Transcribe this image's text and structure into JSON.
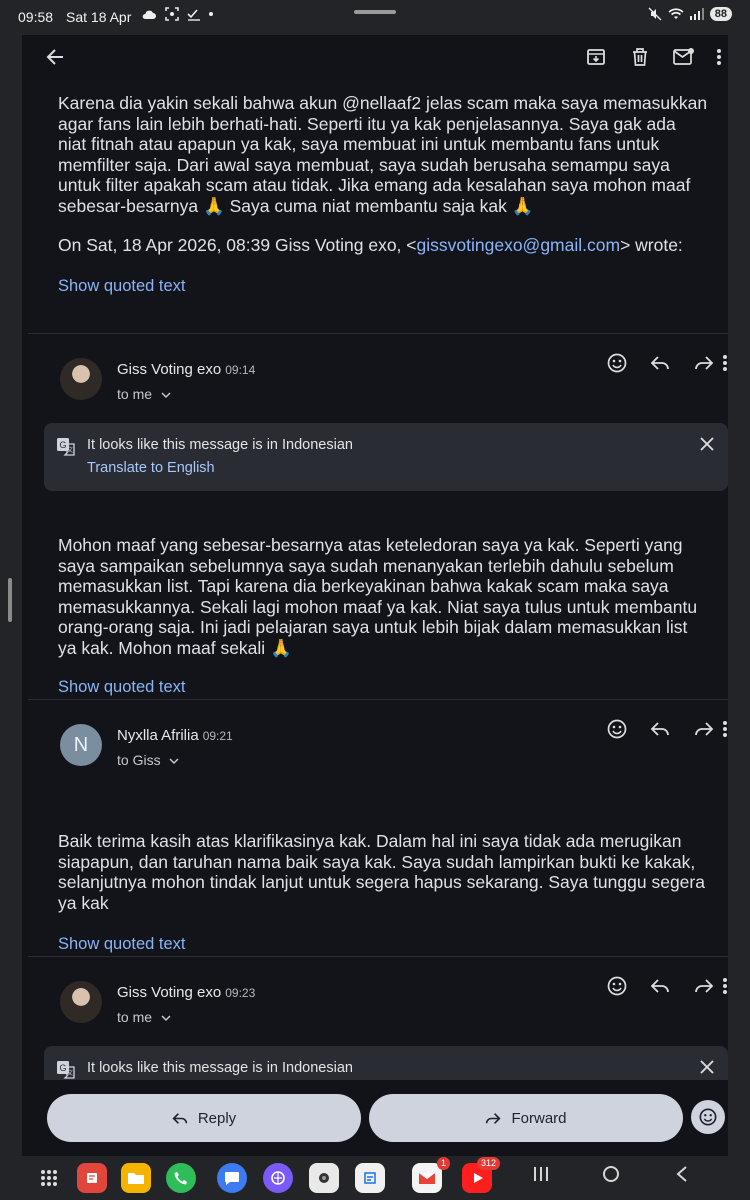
{
  "status": {
    "time": "09:58",
    "date": "Sat 18 Apr",
    "battery": "88"
  },
  "msg1": {
    "body": "Karena dia yakin sekali bahwa akun @nellaaf2 jelas scam maka saya memasukkan agar fans lain lebih berhati-hati. Seperti itu ya kak penjelasannya. Saya gak ada niat fitnah atau apapun ya kak, saya membuat ini untuk membantu fans untuk memfilter saja. Dari awal saya membuat, saya sudah berusaha semampu saya untuk filter apakah scam atau tidak. Jika emang ada kesalahan saya mohon maaf sebesar-besarnya 🙏 Saya cuma niat membantu saja kak 🙏",
    "attrib_prefix": "On Sat, 18 Apr 2026, 08:39 Giss Voting exo, <",
    "attrib_email": "gissvotingexo@gmail.com",
    "attrib_suffix": "> wrote:",
    "quoted": "Show quoted text"
  },
  "msg2": {
    "sender": "Giss Voting exo",
    "time": "09:14",
    "to": "to me",
    "translate_msg": "It looks like this message is in Indonesian",
    "translate_link": "Translate to English",
    "body": "Mohon maaf yang sebesar-besarnya atas keteledoran saya ya kak. Seperti yang saya sampaikan sebelumnya saya sudah menanyakan terlebih dahulu sebelum memasukkan list. Tapi karena dia berkeyakinan bahwa kakak scam maka saya memasukkannya. Sekali lagi mohon maaf ya kak. Niat saya tulus untuk membantu orang-orang saja. Ini jadi pelajaran saya untuk lebih bijak dalam memasukkan list ya kak. Mohon maaf sekali 🙏",
    "quoted": "Show quoted text"
  },
  "msg3": {
    "sender": "Nyxlla Afrilia",
    "initial": "N",
    "time": "09:21",
    "to": "to Giss",
    "body": "Baik terima kasih atas klarifikasinya kak. Dalam hal ini saya tidak ada merugikan siapapun, dan taruhan nama baik saya kak. Saya sudah lampirkan bukti ke kakak, selanjutnya mohon tindak lanjut untuk segera hapus sekarang. Saya tunggu segera ya kak",
    "quoted": "Show quoted text"
  },
  "msg4": {
    "sender": "Giss Voting exo",
    "time": "09:23",
    "to": "to me",
    "translate_msg": "It looks like this message is in Indonesian"
  },
  "actions": {
    "reply": "Reply",
    "forward": "Forward"
  },
  "dock_badges": {
    "gmail": "1",
    "youtube": "312"
  },
  "colors": {
    "link": "#8ab4f8",
    "background": "#111318",
    "pill": "#cfd3de"
  }
}
